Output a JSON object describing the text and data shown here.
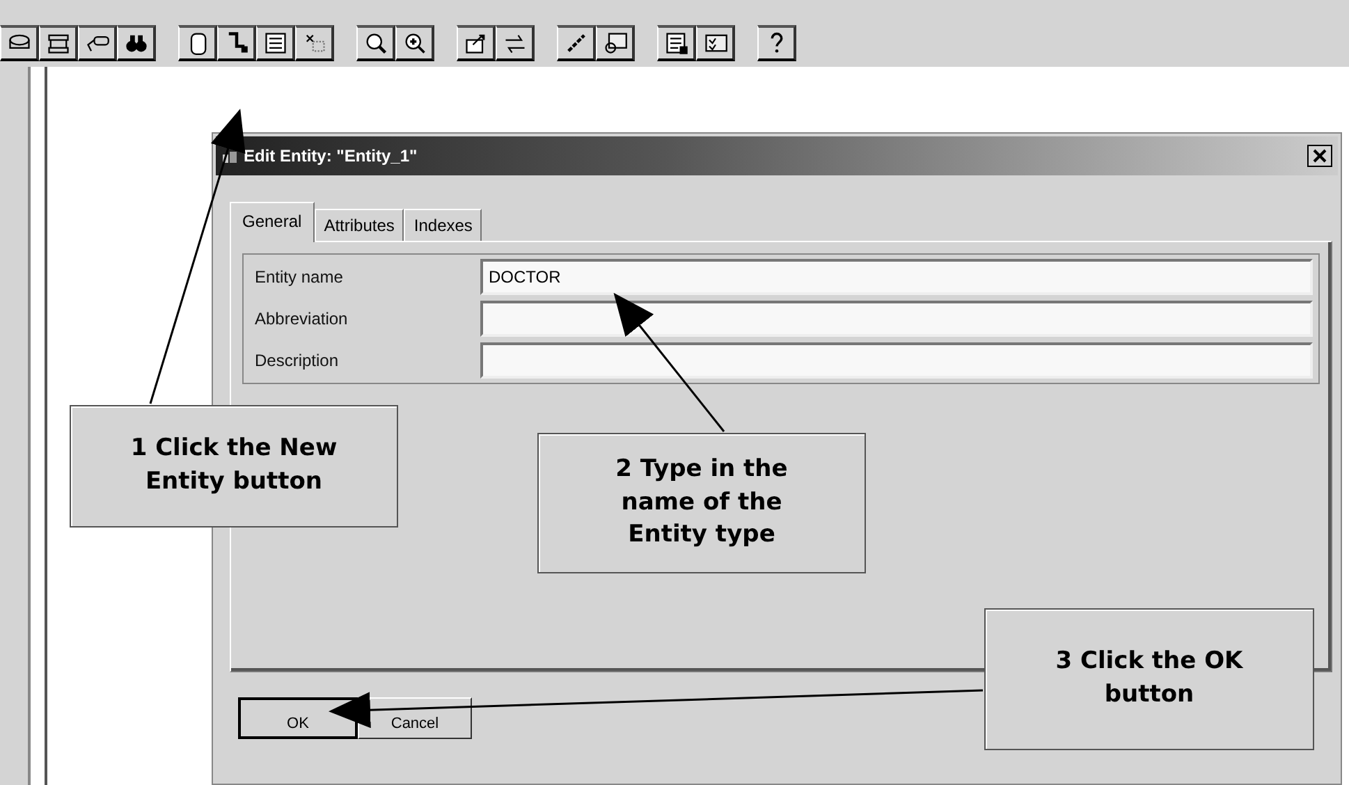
{
  "dialog": {
    "title": "Edit Entity: \"Entity_1\"",
    "tabs": [
      {
        "label": "General",
        "selected": true
      },
      {
        "label": "Attributes",
        "selected": false
      },
      {
        "label": "Indexes",
        "selected": false
      }
    ],
    "fields": [
      {
        "label": "Entity name",
        "value": "DOCTOR"
      },
      {
        "label": "Abbreviation"
      },
      {
        "label": "Description"
      }
    ],
    "buttons": [
      {
        "label": "OK",
        "selected": true
      },
      {
        "label": "Cancel",
        "selected": false
      }
    ]
  },
  "callouts": [
    {
      "text": "1 Click the New\nEntity button"
    },
    {
      "text": "2 Type in the\nname of the\nEntity type"
    },
    {
      "text": "3 Click the OK\nbutton"
    }
  ]
}
